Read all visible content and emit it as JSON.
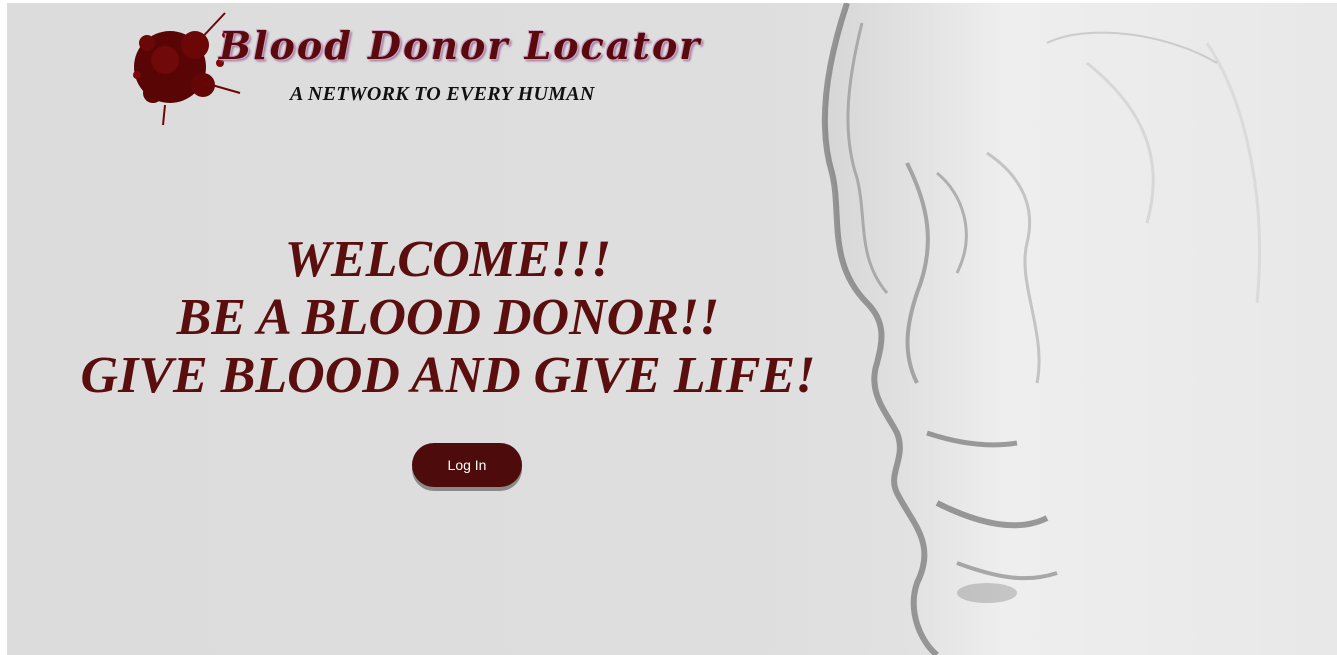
{
  "brand": {
    "title": "Blood Donor Locator",
    "tagline": "A NETWORK TO EVERY HUMAN",
    "logo_icon": "blood-splatter-icon",
    "accent_color": "#5a0a0c"
  },
  "hero": {
    "line1": "WELCOME!!!",
    "line2": "BE A BLOOD DONOR!!",
    "line3": "GIVE BLOOD AND GIVE LIFE!",
    "text_color": "#5b0e0e"
  },
  "actions": {
    "login_label": "Log In",
    "button_color": "#4d0b0b"
  },
  "background": {
    "image": "glass-face-sculpture"
  }
}
